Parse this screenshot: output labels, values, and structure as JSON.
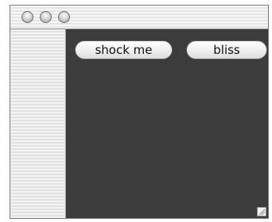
{
  "window": {
    "title_buttons": [
      "close-icon",
      "minimize-icon",
      "zoom-icon"
    ]
  },
  "toolbar": {
    "shock_label": "shock me",
    "bliss_label": "bliss"
  },
  "resize": {
    "icon": "resize-grip-icon"
  }
}
